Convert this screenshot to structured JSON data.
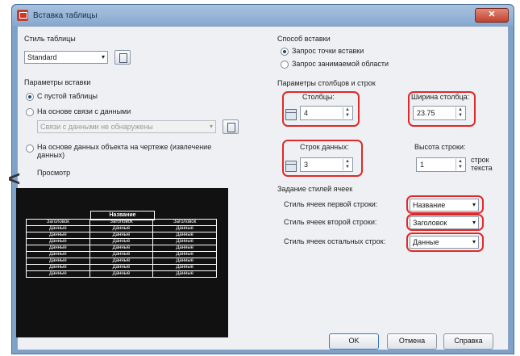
{
  "window": {
    "title": "Вставка таблицы",
    "close": "✕"
  },
  "left": {
    "table_style_label": "Стиль таблицы",
    "table_style_value": "Standard",
    "insert_params_label": "Параметры вставки",
    "opt_empty": "С пустой таблицы",
    "opt_datalink": "На основе связи с данными",
    "datalink_placeholder": "Связи с данными не обнаружены",
    "opt_object_data": "На основе данных объекта на чертеже (извлечение данных)",
    "preview_label": "Просмотр"
  },
  "preview": {
    "title": "Название",
    "header": [
      "Заголовок",
      "Заголовок",
      "Заголовок"
    ],
    "data_cell": "Данные",
    "data_rows": 8
  },
  "right": {
    "insert_method_label": "Способ вставки",
    "opt_point": "Запрос точки вставки",
    "opt_window": "Запрос занимаемой области",
    "colrow_params_label": "Параметры столбцов и строк",
    "columns_label": "Столбцы:",
    "columns_value": "4",
    "col_width_label": "Ширина столбца:",
    "col_width_value": "23.75",
    "data_rows_label": "Строк данных:",
    "data_rows_value": "3",
    "row_height_label": "Высота строки:",
    "row_height_value": "1",
    "row_height_unit": "строк текста",
    "cell_styles_label": "Задание стилей ячеек",
    "first_row_label": "Стиль ячеек первой строки:",
    "first_row_value": "Название",
    "second_row_label": "Стиль ячеек второй строки:",
    "second_row_value": "Заголовок",
    "other_rows_label": "Стиль ячеек остальных строк:",
    "other_rows_value": "Данные"
  },
  "buttons": {
    "ok": "OK",
    "cancel": "Отмена",
    "help": "Справка"
  },
  "icons": {
    "dropdown": "▾",
    "up": "▲",
    "down": "▼",
    "back": "<"
  },
  "colors": {
    "highlight": "#e02a2a",
    "titlebar": "#86a8cf"
  }
}
